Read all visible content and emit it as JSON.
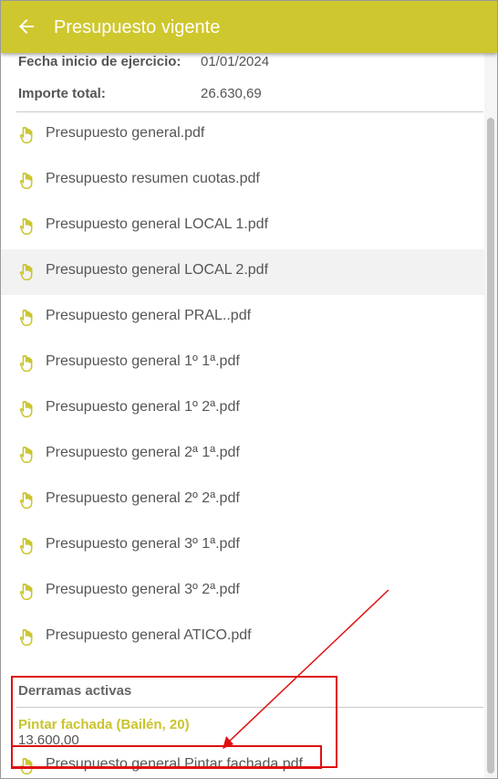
{
  "header": {
    "title": "Presupuesto vigente",
    "back_icon": "arrow-left-icon",
    "bg_color": "#cfc72e"
  },
  "info": {
    "start_label": "Fecha inicio de ejercicio:",
    "start_value": "01/01/2024",
    "total_label": "Importe total:",
    "total_value": "26.630,69"
  },
  "documents": [
    "Presupuesto general.pdf",
    "Presupuesto resumen cuotas.pdf",
    "Presupuesto general LOCAL 1.pdf",
    "Presupuesto general LOCAL 2.pdf",
    "Presupuesto general PRAL..pdf",
    "Presupuesto general 1º 1ª.pdf",
    "Presupuesto general 1º 2ª.pdf",
    "Presupuesto general 2ª 1ª.pdf",
    "Presupuesto general 2º 2ª.pdf",
    "Presupuesto general 3º 1ª.pdf",
    "Presupuesto general 3º 2ª.pdf",
    "Presupuesto general ATICO.pdf"
  ],
  "derramas": {
    "section_title": "Derramas activas",
    "name": "Pintar fachada (Bailén, 20)",
    "amount": "13.600,00",
    "document": "Presupuesto general Pintar fachada.pdf",
    "accent_color": "#c9c42c"
  },
  "icons": {
    "document": "hand-pointer-document-icon"
  },
  "annotation_color": "#e01010"
}
